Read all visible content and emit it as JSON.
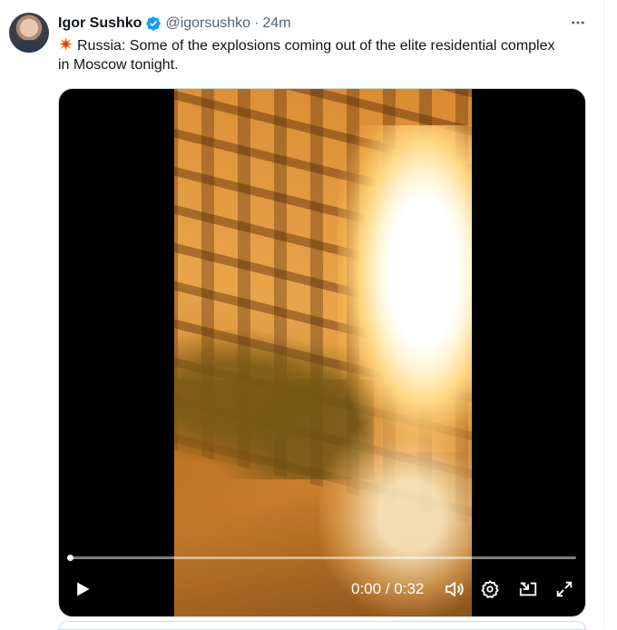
{
  "tweet": {
    "author_name": "Igor Sushko",
    "handle": "@igorsushko",
    "separator": "·",
    "time": "24m",
    "text": "Russia: Some of the explosions coming out of the elite residential complex in Moscow tonight.",
    "emoji_icon": "collision-icon",
    "more_icon": "more-icon",
    "verified_color": "#1d9bf0"
  },
  "video": {
    "current_time": "0:00",
    "time_separator": "/",
    "duration": "0:32",
    "progress": 0.0,
    "icons": {
      "play": "play-icon",
      "volume": "volume-icon",
      "settings": "gear-icon",
      "pip": "picture-in-picture-icon",
      "fullscreen": "fullscreen-icon"
    }
  }
}
